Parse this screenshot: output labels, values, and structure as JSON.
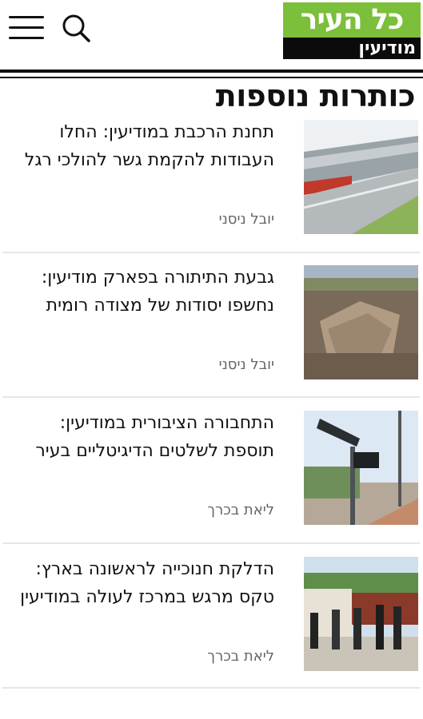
{
  "header": {
    "menu_icon": "hamburger-menu-icon",
    "search_icon": "search-icon",
    "logo_top": "כל העיר",
    "logo_bottom": "מודיעין",
    "brand_color": "#7bbf3a"
  },
  "section": {
    "title": "כותרות נוספות"
  },
  "articles": [
    {
      "headline": "תחנת הרכבת במודיעין: החלו העבודות להקמת גשר להולכי רגל",
      "author": "יובל ניסני"
    },
    {
      "headline": "גבעת התיתורה בפארק מודיעין: נחשפו יסודות של מצודה רומית",
      "author": "יובל ניסני"
    },
    {
      "headline": "התחבורה הציבורית במודיעין: תוספת לשלטים הדיגיטליים בעיר",
      "author": "ליאת בכרך"
    },
    {
      "headline": "הדלקת חנוכייה לראשונה בארץ: טקס מרגש במרכז לעולה במודיעין",
      "author": "ליאת בכרך"
    }
  ]
}
